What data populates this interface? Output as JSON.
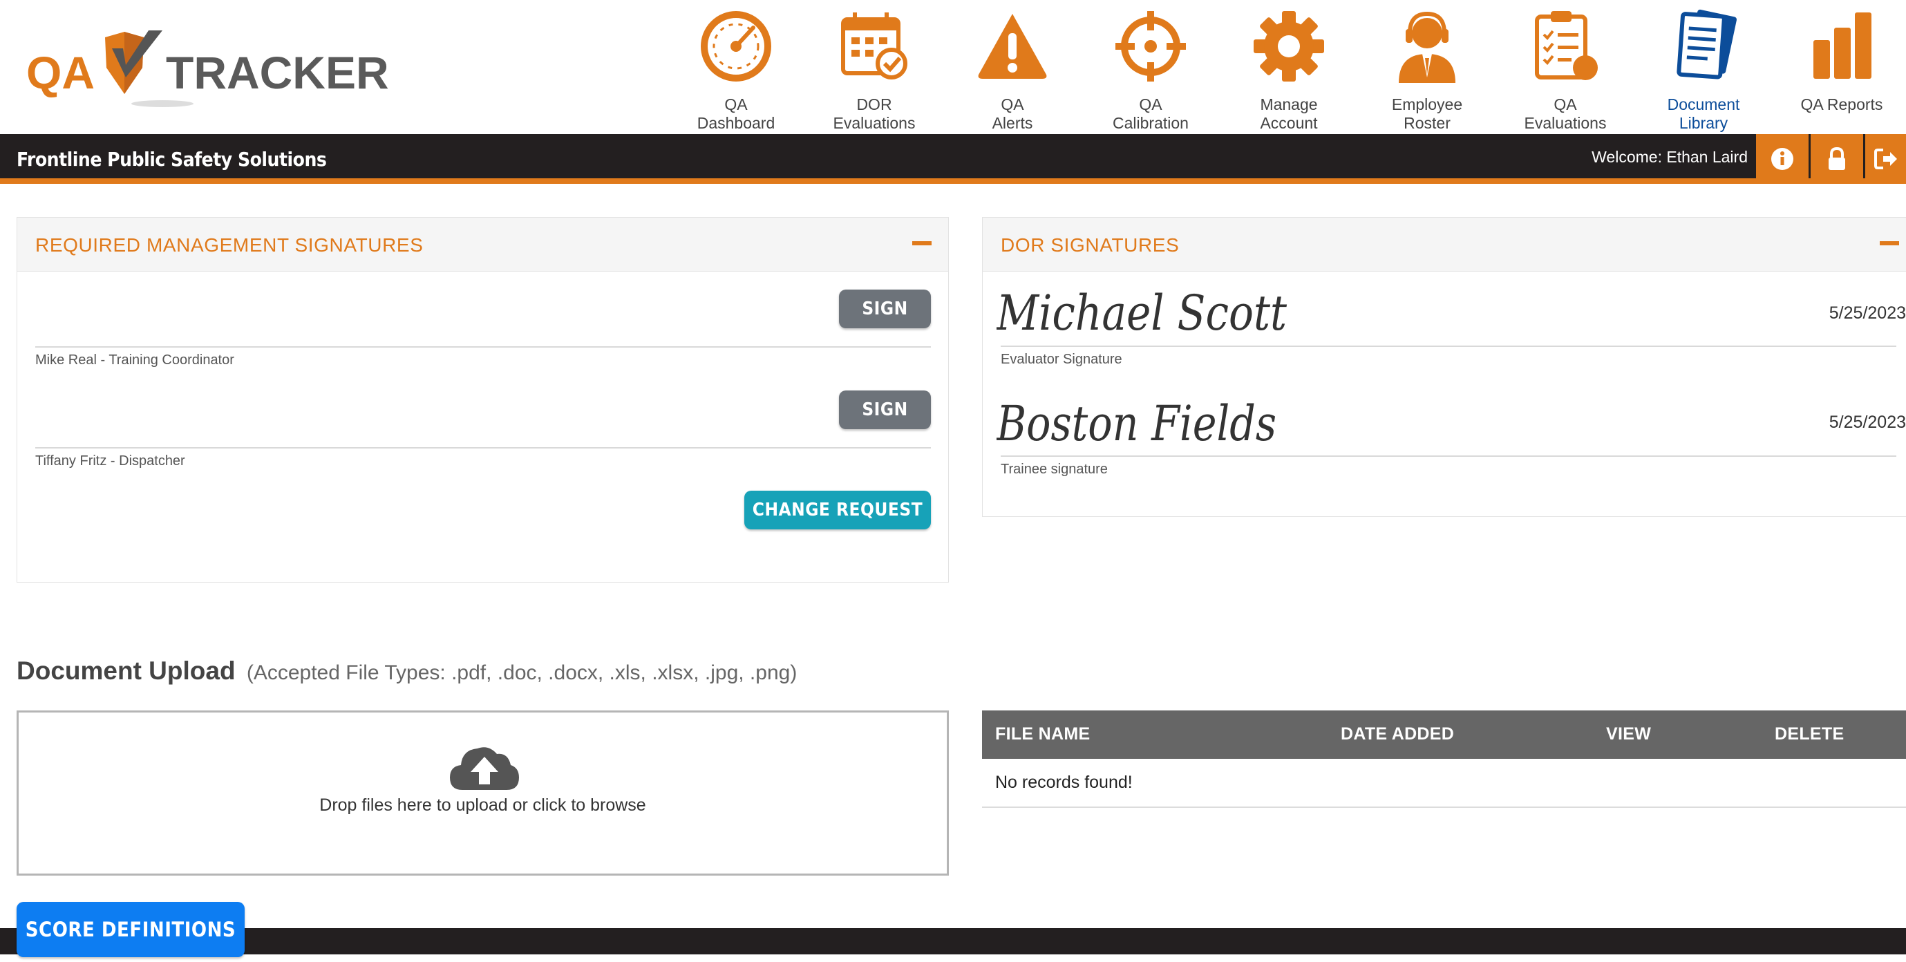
{
  "app": {
    "logo_left": "QA",
    "logo_right": "TRACKER",
    "org_name": "Frontline Public Safety Solutions",
    "welcome": "Welcome: Ethan Laird",
    "accent_color": "#e07a1b",
    "active_color": "#0c4d9a"
  },
  "nav": [
    {
      "label": "QA\nDashboard",
      "icon": "speedometer-icon"
    },
    {
      "label": "DOR\nEvaluations",
      "icon": "calendar-check-icon"
    },
    {
      "label": "QA\nAlerts",
      "icon": "warning-icon"
    },
    {
      "label": "QA\nCalibration",
      "icon": "crosshair-icon"
    },
    {
      "label": "Manage\nAccount",
      "icon": "gear-icon"
    },
    {
      "label": "Employee\nRoster",
      "icon": "headset-person-icon"
    },
    {
      "label": "QA\nEvaluations",
      "icon": "clipboard-checklist-icon"
    },
    {
      "label": "Document\nLibrary",
      "icon": "documents-icon"
    },
    {
      "label": "QA Reports",
      "icon": "bar-chart-icon"
    }
  ],
  "titlebar_buttons": [
    "info-icon",
    "lock-icon",
    "sign-out-icon"
  ],
  "mgmt_panel": {
    "title": "REQUIRED MANAGEMENT SIGNATURES",
    "signers": [
      {
        "caption": "Mike Real - Training Coordinator",
        "button": "SIGN"
      },
      {
        "caption": "Tiffany Fritz - Dispatcher",
        "button": "SIGN"
      }
    ],
    "change_request": "CHANGE REQUEST"
  },
  "dor_panel": {
    "title": "DOR SIGNATURES",
    "signatures": [
      {
        "name": "Michael Scott",
        "caption": "Evaluator Signature",
        "date": "5/25/2023"
      },
      {
        "name": "Boston Fields",
        "caption": "Trainee signature",
        "date": "5/25/2023"
      }
    ]
  },
  "upload": {
    "title": "Document Upload",
    "subtitle": "(Accepted File Types: .pdf, .doc, .docx, .xls, .xlsx, .jpg, .png)",
    "drop_text": "Drop files here to upload or click to browse"
  },
  "files_table": {
    "columns": [
      "FILE NAME",
      "DATE ADDED",
      "VIEW",
      "DELETE"
    ],
    "empty": "No records found!"
  },
  "score_definitions": "SCORE DEFINITIONS"
}
